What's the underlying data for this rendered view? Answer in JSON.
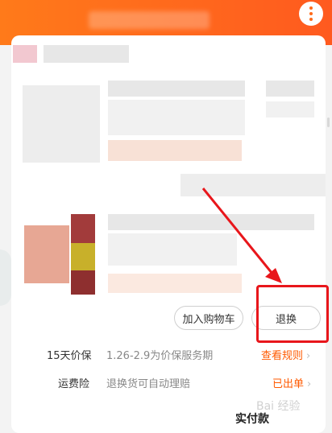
{
  "header": {
    "more_icon": "more-dots-icon",
    "accent_color": "#ff6a1a"
  },
  "actions": {
    "add_to_cart": "加入购物车",
    "return_exchange": "退换"
  },
  "services": [
    {
      "label": "15天价保",
      "text": "1.26-2.9为价保服务期",
      "link": "查看规则"
    },
    {
      "label": "运费险",
      "text": "退换货可自动理赔",
      "link": "已出单"
    }
  ],
  "footer": {
    "total_label": "实付款"
  },
  "annotation": {
    "highlight_color": "#e8161b"
  },
  "watermark": {
    "text": "Bai 经验"
  }
}
